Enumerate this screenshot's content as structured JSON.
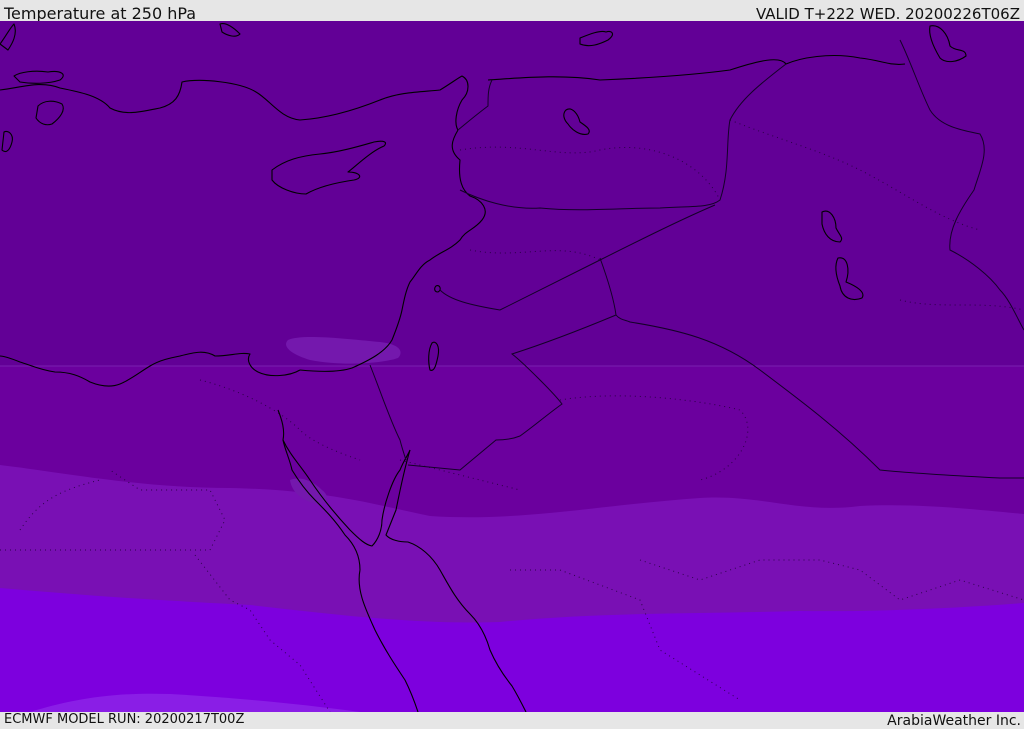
{
  "header": {
    "title": "Temperature at 250 hPa",
    "valid": "VALID T+222 WED. 20200226T06Z"
  },
  "footer": {
    "model_run": "ECMWF MODEL RUN: 20200217T00Z",
    "credit": "ArabiaWeather Inc."
  },
  "colors": {
    "band_coldest": "#620096",
    "band_cold": "#6b009e",
    "band_mid": "#7910b4",
    "band_warm": "#7d00de",
    "band_warmest": "#8a1ee6",
    "pocket": "#7418ad",
    "coastline": "#000000",
    "border": "#1a0030"
  }
}
